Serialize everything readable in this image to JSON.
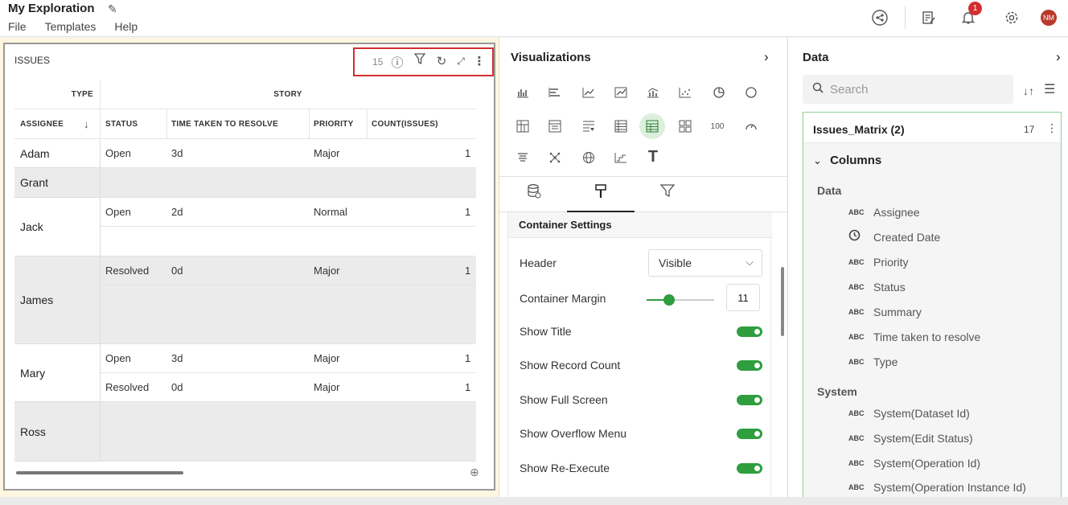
{
  "app": {
    "title": "My Exploration",
    "menus": [
      "File",
      "Templates",
      "Help"
    ],
    "notifications_count": "1",
    "avatar_initials": "NM"
  },
  "widget": {
    "title": "ISSUES",
    "record_count": "15",
    "table": {
      "group_headers": {
        "type": "TYPE",
        "story": "STORY"
      },
      "column_headers": {
        "assignee": "ASSIGNEE",
        "status": "STATUS",
        "time": "TIME TAKEN TO RESOLVE",
        "priority": "PRIORITY",
        "count": "COUNT(ISSUES)"
      },
      "groups": [
        {
          "assignee": "Adam",
          "rows": [
            {
              "status": "Open",
              "time": "3d",
              "priority": "Major",
              "count": "1"
            }
          ]
        },
        {
          "assignee": "Grant",
          "rows": []
        },
        {
          "assignee": "Jack",
          "rows": [
            {
              "status": "Open",
              "time": "2d",
              "priority": "Normal",
              "count": "1"
            }
          ]
        },
        {
          "assignee": "James",
          "rows": [
            {
              "status": "Resolved",
              "time": "0d",
              "priority": "Major",
              "count": "1"
            }
          ]
        },
        {
          "assignee": "Mary",
          "rows": [
            {
              "status": "Open",
              "time": "3d",
              "priority": "Major",
              "count": "1"
            },
            {
              "status": "Resolved",
              "time": "0d",
              "priority": "Major",
              "count": "1"
            }
          ]
        },
        {
          "assignee": "Ross",
          "rows": []
        }
      ]
    }
  },
  "visualizations": {
    "title": "Visualizations",
    "number_icon_label": "100",
    "text_icon_label": "T",
    "settings": {
      "section_title": "Container Settings",
      "header_label": "Header",
      "header_value": "Visible",
      "margin_label": "Container Margin",
      "margin_value": "11",
      "toggles": [
        {
          "label": "Show Title",
          "on": true
        },
        {
          "label": "Show Record Count",
          "on": true
        },
        {
          "label": "Show Full Screen",
          "on": true
        },
        {
          "label": "Show Overflow Menu",
          "on": true
        },
        {
          "label": "Show Re-Execute",
          "on": true
        }
      ]
    }
  },
  "data_panel": {
    "title": "Data",
    "search_placeholder": "Search",
    "dataset_name": "Issues_Matrix (2)",
    "dataset_count": "17",
    "columns_label": "Columns",
    "groups": [
      {
        "label": "Data",
        "fields": [
          {
            "type": "ABC",
            "name": "Assignee"
          },
          {
            "type": "clock",
            "name": "Created Date"
          },
          {
            "type": "ABC",
            "name": "Priority"
          },
          {
            "type": "ABC",
            "name": "Status"
          },
          {
            "type": "ABC",
            "name": "Summary"
          },
          {
            "type": "ABC",
            "name": "Time taken to resolve"
          },
          {
            "type": "ABC",
            "name": "Type"
          }
        ]
      },
      {
        "label": "System",
        "fields": [
          {
            "type": "ABC",
            "name": "System(Dataset Id)"
          },
          {
            "type": "ABC",
            "name": "System(Edit Status)"
          },
          {
            "type": "ABC",
            "name": "System(Operation Id)"
          },
          {
            "type": "ABC",
            "name": "System(Operation Instance Id)"
          }
        ]
      }
    ]
  },
  "colors": {
    "accent_green": "#2e9e3e",
    "highlight_red": "#d32f2f"
  }
}
